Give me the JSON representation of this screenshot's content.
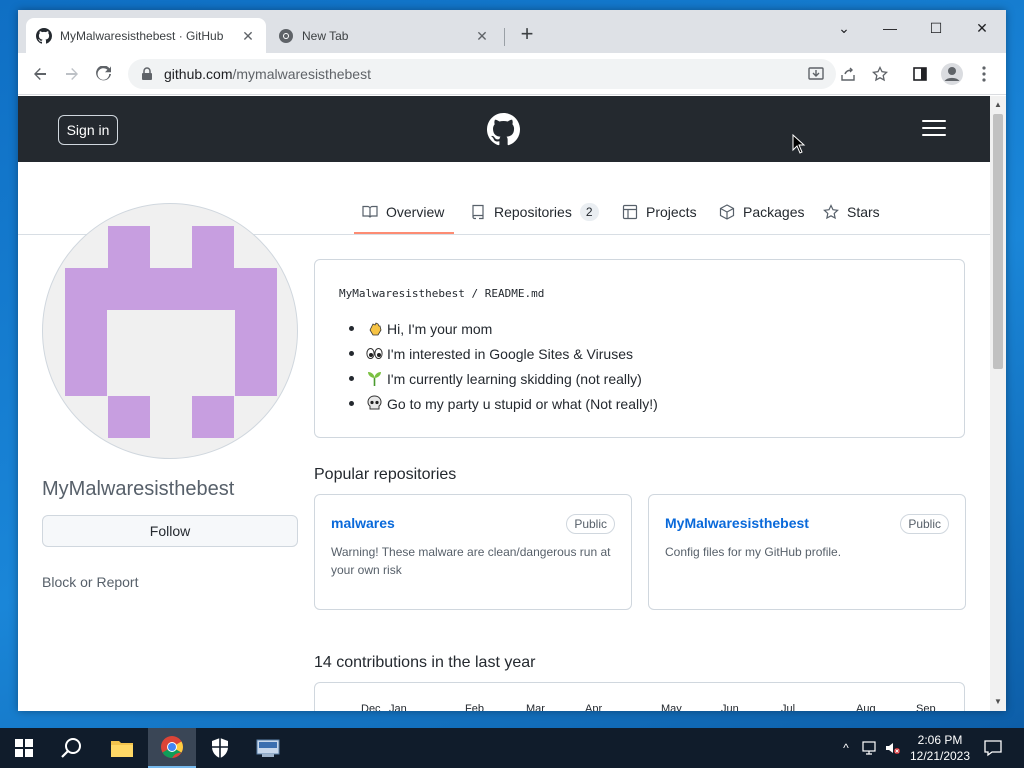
{
  "browser": {
    "tabs": [
      {
        "title": "MyMalwaresisthebest · GitHub",
        "active": true
      },
      {
        "title": "New Tab",
        "active": false
      }
    ],
    "url_domain": "github.com",
    "url_path": "/mymalwaresisthebest"
  },
  "header": {
    "signin_label": "Sign in"
  },
  "profile_tabs": [
    {
      "label": "Overview",
      "icon": "book-icon"
    },
    {
      "label": "Repositories",
      "icon": "repo-icon",
      "count": "2"
    },
    {
      "label": "Projects",
      "icon": "table-icon"
    },
    {
      "label": "Packages",
      "icon": "package-icon"
    },
    {
      "label": "Stars",
      "icon": "star-icon"
    }
  ],
  "sidebar": {
    "username": "MyMalwaresisthebest",
    "follow_label": "Follow",
    "block_label": "Block or Report"
  },
  "readme": {
    "owner": "MyMalwaresisthebest",
    "separator": "/",
    "file": "README.md",
    "items": [
      {
        "emoji": "waving-hand-icon",
        "text": "Hi, I'm your mom"
      },
      {
        "emoji": "eyes-icon",
        "text": "I'm interested in Google Sites & Viruses"
      },
      {
        "emoji": "seedling-icon",
        "text": "I'm currently learning skidding (not really)"
      },
      {
        "emoji": "skull-icon",
        "text": "Go to my party u stupid or what (Not really!)"
      }
    ]
  },
  "popular": {
    "title": "Popular repositories",
    "repos": [
      {
        "name": "malwares",
        "badge": "Public",
        "description": "Warning! These malware are clean/dangerous run at your own risk"
      },
      {
        "name": "MyMalwaresisthebest",
        "badge": "Public",
        "description": "Config files for my GitHub profile."
      }
    ]
  },
  "contributions": {
    "title": "14 contributions in the last year",
    "months": [
      "Dec",
      "Jan",
      "Feb",
      "Mar",
      "Apr",
      "May",
      "Jun",
      "Jul",
      "Aug",
      "Sep"
    ]
  },
  "taskbar": {
    "time": "2:06 PM",
    "date": "12/21/2023"
  },
  "colors": {
    "accent_link": "#0969da",
    "header_bg": "#24292f",
    "tab_underline": "#fd8c73",
    "avatar_purple": "#c79ee0"
  }
}
